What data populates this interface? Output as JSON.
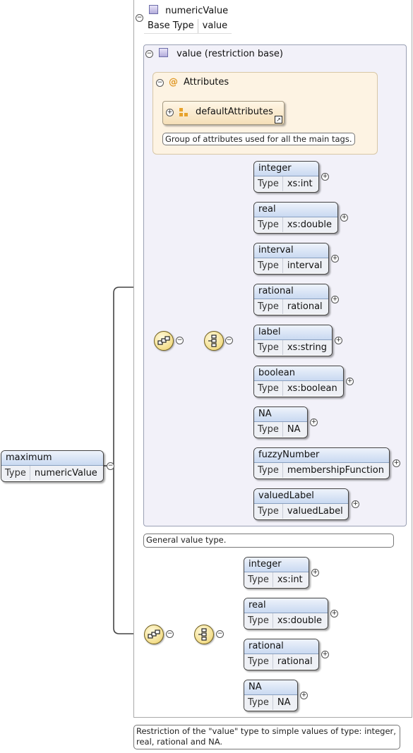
{
  "root": {
    "name": "maximum",
    "type_key": "Type",
    "type_value": "numericValue"
  },
  "numeric_value": {
    "title": "numericValue",
    "base_key": "Base Type",
    "base_value": "value"
  },
  "value_section": {
    "title": "value (restriction base)"
  },
  "attributes": {
    "title": "Attributes",
    "group_name": "defaultAttributes",
    "group_note": "Group of attributes used for all the main tags."
  },
  "choice_elements": [
    {
      "name": "integer",
      "type_key": "Type",
      "type_value": "xs:int"
    },
    {
      "name": "real",
      "type_key": "Type",
      "type_value": "xs:double"
    },
    {
      "name": "interval",
      "type_key": "Type",
      "type_value": "interval"
    },
    {
      "name": "rational",
      "type_key": "Type",
      "type_value": "rational"
    },
    {
      "name": "label",
      "type_key": "Type",
      "type_value": "xs:string"
    },
    {
      "name": "boolean",
      "type_key": "Type",
      "type_value": "xs:boolean"
    },
    {
      "name": "NA",
      "type_key": "Type",
      "type_value": "NA"
    },
    {
      "name": "fuzzyNumber",
      "type_key": "Type",
      "type_value": "membershipFunction"
    },
    {
      "name": "valuedLabel",
      "type_key": "Type",
      "type_value": "valuedLabel"
    }
  ],
  "value_note": "General value type.",
  "restriction_elements": [
    {
      "name": "integer",
      "type_key": "Type",
      "type_value": "xs:int"
    },
    {
      "name": "real",
      "type_key": "Type",
      "type_value": "xs:double"
    },
    {
      "name": "rational",
      "type_key": "Type",
      "type_value": "rational"
    },
    {
      "name": "NA",
      "type_key": "Type",
      "type_value": "NA"
    }
  ],
  "restriction_note": "Restriction of the \"value\" type to simple values of type: integer, real, rational and NA.",
  "symbols": {
    "collapse": "−",
    "expand": "+",
    "at": "@"
  },
  "colors": {
    "element_header": "#c9d9f1",
    "panel": "#f2f1f9",
    "attributes_panel": "#fdf3e3",
    "compositor": "#f3dd8a"
  }
}
